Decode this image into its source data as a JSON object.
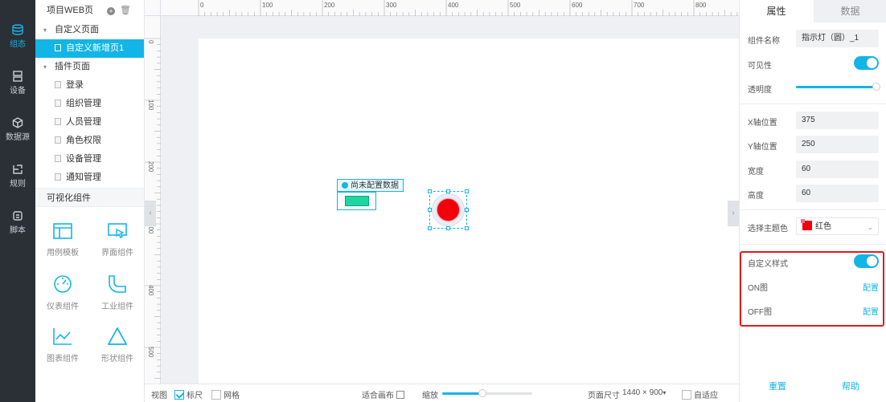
{
  "rail": [
    {
      "label": "组态",
      "icon": "layers-icon",
      "active": true
    },
    {
      "label": "设备",
      "icon": "device-icon",
      "active": false
    },
    {
      "label": "数据源",
      "icon": "cube-icon",
      "active": false
    },
    {
      "label": "规则",
      "icon": "rule-icon",
      "active": false
    },
    {
      "label": "脚本",
      "icon": "script-icon",
      "active": false
    }
  ],
  "tree": {
    "title": "项目WEB页",
    "groups": [
      {
        "label": "自定义页面",
        "items": [
          {
            "label": "自定义新增页1",
            "selected": true
          }
        ]
      },
      {
        "label": "插件页面",
        "items": [
          {
            "label": "登录"
          },
          {
            "label": "组织管理"
          },
          {
            "label": "人员管理"
          },
          {
            "label": "角色权限"
          },
          {
            "label": "设备管理"
          },
          {
            "label": "通知管理"
          }
        ]
      }
    ],
    "vis_title": "可视化组件",
    "components": [
      {
        "label": "用例模板",
        "icon": "template-icon"
      },
      {
        "label": "界面组件",
        "icon": "pointer-window-icon"
      },
      {
        "label": "仪表组件",
        "icon": "gauge-icon"
      },
      {
        "label": "工业组件",
        "icon": "pipe-icon"
      },
      {
        "label": "图表组件",
        "icon": "line-chart-icon"
      },
      {
        "label": "形状组件",
        "icon": "triangle-icon"
      }
    ]
  },
  "ruler": {
    "top": [
      "0",
      "100",
      "200",
      "300",
      "400",
      "500",
      "600",
      "700",
      "800"
    ],
    "left": [
      "0",
      "100",
      "200",
      "300",
      "400",
      "500"
    ]
  },
  "canvas": {
    "tip_text": "尚未配置数据"
  },
  "bottom": {
    "view": "视图",
    "ruler": "标尺",
    "ruler_checked": true,
    "grid": "网格",
    "grid_checked": false,
    "fit_canvas": "适合画布",
    "zoom": "缩放",
    "zoom_level": 0.45,
    "page_size_label": "页面尺寸",
    "page_size": "1440 × 900",
    "auto_fit": "自适应",
    "auto_fit_checked": false
  },
  "props": {
    "tab_props": "属性",
    "tab_data": "数据",
    "name_label": "组件名称",
    "name_value": "指示灯（圆）_1",
    "visible_label": "可见性",
    "visible_on": true,
    "opacity_label": "透明度",
    "opacity": 1.0,
    "x_label": "X轴位置",
    "x_value": "375",
    "y_label": "Y轴位置",
    "y_value": "250",
    "w_label": "宽度",
    "w_value": "60",
    "h_label": "高度",
    "h_value": "60",
    "theme_label": "选择主题色",
    "theme_value": "红色",
    "theme_color": "#f5000a",
    "custom_style_label": "自定义样式",
    "custom_style_on": true,
    "on_label": "ON图",
    "off_label": "OFF图",
    "configure": "配置",
    "reset": "重置",
    "help": "帮助"
  },
  "colors": {
    "accent": "#13b5e6",
    "highlight_box": "#e21b1b",
    "lamp": "#f5000a"
  }
}
